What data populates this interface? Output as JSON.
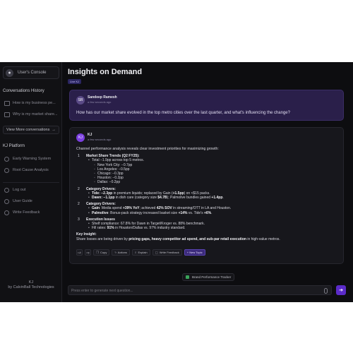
{
  "sidebar": {
    "console_label": "User's Console",
    "conversations_heading": "Conversations History",
    "conversations": [
      {
        "label": "How is my business pe..."
      },
      {
        "label": "Why is my market share..."
      }
    ],
    "view_more_label": "View  More conversations",
    "platform_heading": "KJ Platform",
    "platform_items": [
      {
        "label": "Early Warning System"
      },
      {
        "label": "Root Cause Analysis"
      }
    ],
    "account_items": [
      {
        "label": "Log out"
      },
      {
        "label": "User Guide"
      },
      {
        "label": "Write Feedback"
      }
    ],
    "brand_name": "KJ",
    "brand_by": "by CalvinBall Technologies"
  },
  "main": {
    "title": "Insights on Demand",
    "user_badge": "Live KJ"
  },
  "user_message": {
    "avatar": "SR",
    "name": "Sandeep Ramesh",
    "time": "a few seconds ago",
    "text": "How has our market share evolved in the top metro cities over the last quarter, and what's influencing the change?"
  },
  "ai_message": {
    "avatar": "KJ",
    "name": "KJ",
    "time": "a few seconds ago",
    "intro": "Channel performance analysis reveals clear investment priorities for maximizing growth:",
    "s1": {
      "num": "1",
      "title": "Market Share Trends (Q2 FY25):",
      "total": "Total −1.9pp across top 5 metros.",
      "cities": [
        "New York City: −0.7pp",
        "Los Angeles: −0.5pp",
        "Chicago: −0.3pp",
        "Houston: −0.2pp",
        "Dallas: −0.2pp"
      ]
    },
    "s2": {
      "num": "2",
      "title": "Category Drivers:",
      "tide_kw": "Tide",
      "tide_val": ": −2.3pp",
      "tide_rest": " in premium liquids; replaced by Gain (",
      "tide_kw2": "+1.5pp",
      "tide_end": ") on <$15 packs.",
      "dawn_kw": "Dawn",
      "dawn_val": ": −1.1pp",
      "dawn_rest": " in dish care (category size ",
      "dawn_kw2": "$4.7B",
      "dawn_mid": "); Palmolive bundles gained ",
      "dawn_kw3": "+1.4pp",
      "dawn_end": "."
    },
    "s3": {
      "num": "2",
      "title": "Category Drivers:",
      "gain_kw": "Gain",
      "gain_a": ": Media spend ",
      "gain_kw2": "+39% YoY",
      "gain_b": "; achieved ",
      "gain_kw3": "42% SOV",
      "gain_c": " in streaming/OTT in LA and Houston.",
      "palm_kw": "Palmolive",
      "palm_a": ": Bonus-pack strategy increased basket size ",
      "palm_kw2": "+14%",
      "palm_b": " vs. Tide's ",
      "palm_kw3": "+6%",
      "palm_c": "."
    },
    "s4": {
      "num": "3",
      "title": "Execution Issues",
      "line1": "Shelf compliance: 67.8% for Dawn in Target/Kroger vs. 88% benchmark.",
      "fill_a": "Fill rates: ",
      "fill_kw": "91%",
      "fill_b": " in Houston/Dallas vs. 97% industry standard."
    },
    "key_title": "Key Insight:",
    "key_a": "Share losses are being driven by ",
    "key_kw": "pricing gaps, heavy competitor ad spend, and sub-par retail execution",
    "key_b": " in high-value metros.",
    "actions": {
      "copy": "Copy",
      "actions": "Actions",
      "explain": "Explain",
      "feedback": "Write Feedback",
      "new_topic": "+ New Topic"
    }
  },
  "suggestion_chip": "Brand Performance Tracker",
  "composer": {
    "placeholder": "Press enter to generate next question..."
  }
}
